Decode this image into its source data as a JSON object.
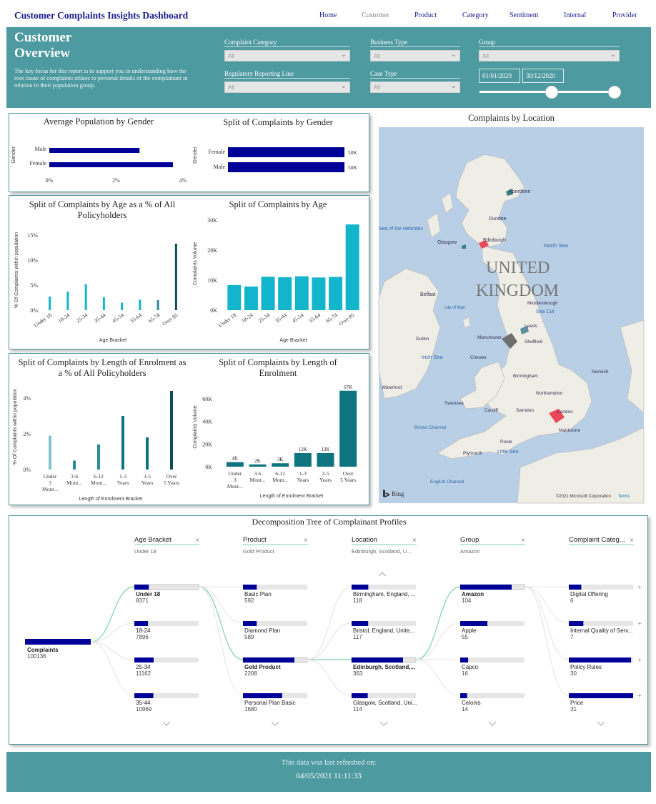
{
  "nav": {
    "brand": "Customer Complaints Insights Dashboard",
    "links": [
      "Home",
      "Customer",
      "Product",
      "Category",
      "Sentiment",
      "Internal",
      "Provider"
    ],
    "active": "Customer"
  },
  "header": {
    "title": "Customer Overview",
    "description": "The key focus for this report is to support you in understanding how the root cause of complaints relates to personal details of the complainant in relation to their population group.",
    "filters": [
      {
        "label": "Complaint Category",
        "value": "All"
      },
      {
        "label": "Business Type",
        "value": "All"
      },
      {
        "label": "Group",
        "value": "All"
      },
      {
        "label": "Regulatory Reporting Line",
        "value": "All"
      },
      {
        "label": "Case Type",
        "value": "All"
      }
    ],
    "date_start": "01/01/2020",
    "date_end": "30/12/2020"
  },
  "chart_data": [
    {
      "type": "bar",
      "orientation": "horizontal",
      "title": "Average Population by Gender",
      "categories": [
        "Male",
        "Female"
      ],
      "values": [
        2.7,
        3.7
      ],
      "value_unit": "%",
      "ylabel": "Gender",
      "ticks": [
        "0%",
        "2%",
        "4%"
      ],
      "xlim": [
        0,
        4
      ]
    },
    {
      "type": "bar",
      "orientation": "horizontal",
      "title": "Split of Complaints by Gender",
      "categories": [
        "Female",
        "Male"
      ],
      "values": [
        50000,
        50000
      ],
      "data_labels": [
        "50K",
        "50K"
      ],
      "ylabel": "Gender"
    },
    {
      "type": "bar",
      "title": "Split of Complaints by Age as a % of All Policyholders",
      "categories": [
        "Under 18",
        "18-24",
        "25-34",
        "35-44",
        "45-54",
        "55-64",
        "65-74",
        "Over 85"
      ],
      "values": [
        2.7,
        3.7,
        5.2,
        2.6,
        1.5,
        2.1,
        2.0,
        13.3
      ],
      "xlabel": "Age Bracket",
      "ylabel": "% Of Complaints within population",
      "ticks": [
        "0%",
        "5%",
        "10%",
        "15%"
      ],
      "ylim": [
        0,
        16
      ]
    },
    {
      "type": "bar",
      "title": "Split of Complaints by Age",
      "categories": [
        "Under 18",
        "18-24",
        "25-34",
        "35-44",
        "45-54",
        "55-64",
        "65-74",
        "Over 85"
      ],
      "values": [
        8371,
        7896,
        11162,
        10969,
        11300,
        10900,
        11100,
        28600
      ],
      "xlabel": "Age Bracket",
      "ylabel": "Complaints Volume",
      "ticks": [
        "0K",
        "10K",
        "20K",
        "30K"
      ],
      "ylim": [
        0,
        31000
      ]
    },
    {
      "type": "bar",
      "title": "Split of Complaints by Length of Enrolment as a % of All Policyholders",
      "categories": [
        "Under 3 Mont...",
        "3-6 Mont...",
        "6-12 Mont...",
        "1-3 Years",
        "3-5 Years",
        "Over 5 Years"
      ],
      "values": [
        1.9,
        0.5,
        1.4,
        3.0,
        1.8,
        4.4
      ],
      "xlabel": "Length of Enrolment Bracket",
      "ylabel": "% Of Complaints within population",
      "ticks": [
        "0%",
        "2%",
        "4%"
      ],
      "ylim": [
        0,
        4.8
      ]
    },
    {
      "type": "bar",
      "title": "Split of Complaints by Length of Enrolment",
      "categories": [
        "Under 3 Mont...",
        "3-6 Mont...",
        "6-12 Mont...",
        "1-3 Years",
        "3-5 Years",
        "Over 5 Years"
      ],
      "values": [
        4000,
        2000,
        3000,
        12000,
        12000,
        67000
      ],
      "data_labels": [
        "4K",
        "2K",
        "3K",
        "12K",
        "12K",
        "67K"
      ],
      "xlabel": "Length of Enrolment Bracket",
      "ylabel": "Complaints Volume",
      "ticks": [
        "0K",
        "20K",
        "40K",
        "60K"
      ],
      "ylim": [
        0,
        70000
      ]
    }
  ],
  "map": {
    "title": "Complaints by Location",
    "country_label": "UNITED KINGDOM",
    "places": [
      "Aberdeen",
      "Dundee",
      "Edinburgh",
      "Glasgow",
      "North Sea",
      "Sea of the Hebrides",
      "Belfast",
      "Isle of Man",
      "Middlesbrough",
      "Sea Cut",
      "Leeds",
      "Manchester",
      "Sheffield",
      "Dublin",
      "Irish Sea",
      "Chester",
      "Birmingham",
      "Northampton",
      "Norwich",
      "Waterford",
      "Cardiff",
      "Swindon",
      "London",
      "Bristol Channel",
      "Maidstone",
      "Swansea",
      "Poole",
      "Little Sea",
      "Plymouth",
      "English Channel"
    ],
    "bing": "Bing",
    "copyright": "©2021 Microsoft Corporation",
    "terms": "Terms"
  },
  "decomp": {
    "title": "Decomposition Tree of Complainant Profiles",
    "root": {
      "label": "Complaints",
      "value": "100136"
    },
    "columns": [
      {
        "header": "Age Bracket",
        "selected": "Under 18",
        "nodes": [
          {
            "label": "Under 18",
            "value": "8371"
          },
          {
            "label": "18-24",
            "value": "7896"
          },
          {
            "label": "25-34",
            "value": "11162"
          },
          {
            "label": "35-44",
            "value": "10969"
          }
        ]
      },
      {
        "header": "Product",
        "selected": "Gold Product",
        "nodes": [
          {
            "label": "Basic Plan",
            "value": "592"
          },
          {
            "label": "Diamond Plan",
            "value": "589"
          },
          {
            "label": "Gold Product",
            "value": "2208"
          },
          {
            "label": "Personal Plan Basic",
            "value": "1680"
          }
        ]
      },
      {
        "header": "Location",
        "selected": "Edinburgh, Scotland, U...",
        "nodes": [
          {
            "label": "Birmingham, England, ...",
            "value": "118"
          },
          {
            "label": "Bristol, England, Unite...",
            "value": "117"
          },
          {
            "label": "Edinburgh, Scotland,...",
            "value": "363"
          },
          {
            "label": "Glasgow, Scotland, Uni...",
            "value": "114"
          }
        ]
      },
      {
        "header": "Group",
        "selected": "Amazon",
        "nodes": [
          {
            "label": "Amazon",
            "value": "104"
          },
          {
            "label": "Apple",
            "value": "55"
          },
          {
            "label": "Capco",
            "value": "16"
          },
          {
            "label": "Celonis",
            "value": "14"
          }
        ]
      },
      {
        "header": "Complaint Categ...",
        "selected": "",
        "nodes": [
          {
            "label": "Digital Offering",
            "value": "6"
          },
          {
            "label": "Internal Quality of Serv...",
            "value": "7"
          },
          {
            "label": "Policy Rules",
            "value": "30"
          },
          {
            "label": "Price",
            "value": "31"
          }
        ]
      }
    ]
  },
  "footer": {
    "line1": "This data was last refreshed on:",
    "line2": "04/05/2021 11:11:33"
  },
  "colors": {
    "teal": "#4e9aa1",
    "navy": "#1a1a8c",
    "bar_navy": "#000099",
    "bar_cyan": "#12b5cb",
    "bar_teal_light": "#7fc3cc",
    "bar_teal_mid": "#2a8a96",
    "bar_teal_dark": "#0e4d56",
    "bar_teal": "#0e7480"
  }
}
